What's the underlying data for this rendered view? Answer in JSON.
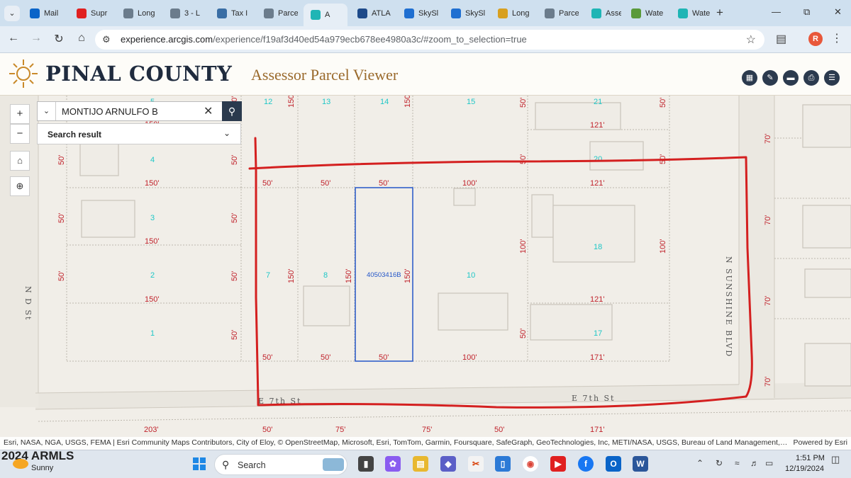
{
  "browser": {
    "tabs": [
      {
        "label": "Mail",
        "icon": "outlook-icon",
        "color": "#0a64c8"
      },
      {
        "label": "Supr",
        "icon": "youtube-icon",
        "color": "#e02020"
      },
      {
        "label": "Long",
        "icon": "globe-icon",
        "color": "#6b7c8c"
      },
      {
        "label": "3 - L",
        "icon": "globe-icon",
        "color": "#6b7c8c"
      },
      {
        "label": "Tax I",
        "icon": "pointer-icon",
        "color": "#3a6ea5"
      },
      {
        "label": "Parce",
        "icon": "globe-icon",
        "color": "#6b7c8c"
      },
      {
        "label": "A",
        "icon": "arcgis-icon",
        "color": "#1fb5b5"
      },
      {
        "label": "ATLA",
        "icon": "atlas-icon",
        "color": "#1d4a8a"
      },
      {
        "label": "SkySl",
        "icon": "skyslope-icon",
        "color": "#1f6fd1"
      },
      {
        "label": "SkySl",
        "icon": "skyslope-icon",
        "color": "#1f6fd1"
      },
      {
        "label": "Long",
        "icon": "long-icon",
        "color": "#d8a020"
      },
      {
        "label": "Parce",
        "icon": "globe-icon",
        "color": "#6b7c8c"
      },
      {
        "label": "Asse",
        "icon": "arcgis-icon",
        "color": "#1fb5b5"
      },
      {
        "label": "Wate",
        "icon": "water-icon",
        "color": "#5a9a3a"
      },
      {
        "label": "Wate",
        "icon": "arcgis-icon",
        "color": "#1fb5b5"
      }
    ],
    "url_host": "experience.arcgis.com",
    "url_path": "/experience/f19af3d40ed54a979ecb678ee4980a3c/#zoom_to_selection=true",
    "profile_initial": "R"
  },
  "app": {
    "org_title": "PINAL COUNTY",
    "app_title": "Assessor Parcel Viewer"
  },
  "search": {
    "value": "MONTIJO ARNULFO B",
    "result_label": "Search result"
  },
  "map": {
    "parcel_numbers": [
      "5",
      "4",
      "3",
      "2",
      "1",
      "12",
      "13",
      "14",
      "15",
      "21",
      "20",
      "7",
      "8",
      "10",
      "18",
      "17"
    ],
    "selected_parcel_id": "40503416B",
    "dimension_labels": [
      "150'",
      "50'",
      "100'",
      "121'",
      "171'",
      "203'",
      "75'",
      "70'"
    ],
    "streets": [
      "N D St",
      "E 7th St",
      "E 7th St",
      "N SUNSHINE BLVD"
    ]
  },
  "attribution": {
    "text": "Esri, NASA, NGA, USGS, FEMA | Esri Community Maps Contributors, City of Eloy, © OpenStreetMap, Microsoft, Esri, TomTom, Garmin, Foursquare, SafeGraph, GeoTechnologies, Inc, METI/NASA, USGS, Bureau of Land Management,…",
    "powered_by": "Powered by Esri"
  },
  "taskbar": {
    "watermark": "2024 ARMLS",
    "weather": "Sunny",
    "search_label": "Search",
    "time": "1:51 PM",
    "date": "12/19/2024"
  },
  "colors": {
    "markup_line": "#d42020",
    "selected_outline": "#2456c8",
    "parcel_number": "#1fc7c7",
    "dimension": "#c0222b",
    "header_navy": "#2b3a4e",
    "title_gold": "#9a6a2c"
  }
}
